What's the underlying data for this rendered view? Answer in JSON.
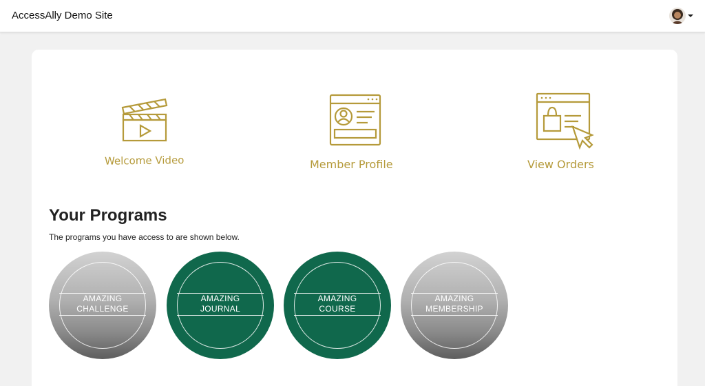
{
  "header": {
    "site_title": "AccessAlly Demo Site"
  },
  "user_menu": {
    "avatar": "avatar-icon",
    "dropdown": "caret-down-icon"
  },
  "quick_links": [
    {
      "label": "Welcome Video",
      "icon": "clapperboard-play-icon"
    },
    {
      "label": "Member Profile",
      "icon": "profile-card-icon"
    },
    {
      "label": "View Orders",
      "icon": "shopping-browser-cursor-icon"
    }
  ],
  "programs": {
    "heading": "Your Programs",
    "description": "The programs you have access to are shown below.",
    "items": [
      {
        "line1": "AMAZING",
        "line2": "CHALLENGE",
        "color": "gray"
      },
      {
        "line1": "AMAZING",
        "line2": "JOURNAL",
        "color": "green"
      },
      {
        "line1": "AMAZING",
        "line2": "COURSE",
        "color": "green"
      },
      {
        "line1": "AMAZING",
        "line2": "MEMBERSHIP",
        "color": "gray"
      }
    ]
  },
  "colors": {
    "accent_gold": "#b59a3a",
    "program_green": "#10684c",
    "program_gray": "#9c9c9c",
    "page_background": "#f1f1f1"
  }
}
